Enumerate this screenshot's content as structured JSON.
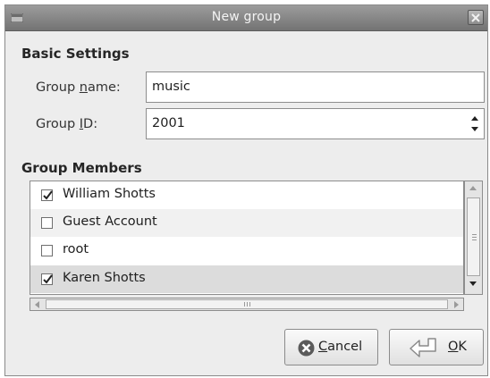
{
  "window": {
    "title": "New group",
    "icon": "window-menu-icon",
    "close": "close-icon"
  },
  "basic_settings": {
    "heading": "Basic Settings",
    "group_name_label_pre": "Group ",
    "group_name_label_u": "n",
    "group_name_label_post": "ame:",
    "group_name_value": "music",
    "group_id_label_pre": "Group ",
    "group_id_label_u": "I",
    "group_id_label_post": "D:",
    "group_id_value": "2001"
  },
  "group_members": {
    "heading": "Group Members",
    "members": [
      {
        "name": "William Shotts",
        "checked": true
      },
      {
        "name": "Guest Account",
        "checked": false
      },
      {
        "name": "root",
        "checked": false
      },
      {
        "name": "Karen Shotts",
        "checked": true
      }
    ]
  },
  "buttons": {
    "cancel_u": "C",
    "cancel_rest": "ancel",
    "cancel_icon": "cancel-icon",
    "ok_u": "O",
    "ok_rest": "K",
    "ok_icon": "enter-arrow-icon"
  }
}
